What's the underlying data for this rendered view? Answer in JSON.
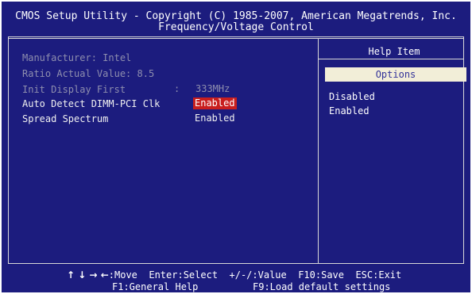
{
  "header": {
    "line1": "CMOS Setup Utility - Copyright (C) 1985-2007, American Megatrends, Inc.",
    "line2": "Frequency/Voltage Control"
  },
  "settings": {
    "manufacturer": "Manufacturer: Intel",
    "ratio": "Ratio Actual Value: 8.5",
    "init_label": "Init Display First",
    "init_sep": ":",
    "init_value": "333MHz",
    "auto_detect_label": "Auto Detect DIMM-PCI Clk",
    "auto_detect_value": "Enabled",
    "spread_label": "Spread Spectrum",
    "spread_value": "Enabled"
  },
  "help": {
    "title": "Help Item",
    "options_header": "Options",
    "options": [
      "Disabled",
      "Enabled"
    ]
  },
  "footer": {
    "arrows": "↑ ↓ → ←",
    "move": ":Move",
    "enter": "Enter:Select",
    "value": "+/-/:Value",
    "save": "F10:Save",
    "exit": "ESC:Exit",
    "general_help": "F1:General Help",
    "load_defaults": "F9:Load default settings"
  },
  "colors": {
    "background": "#1c1c7e",
    "highlight": "#c81e1e",
    "options_bar": "#f2eed8",
    "dim_text": "#8e8eae"
  }
}
